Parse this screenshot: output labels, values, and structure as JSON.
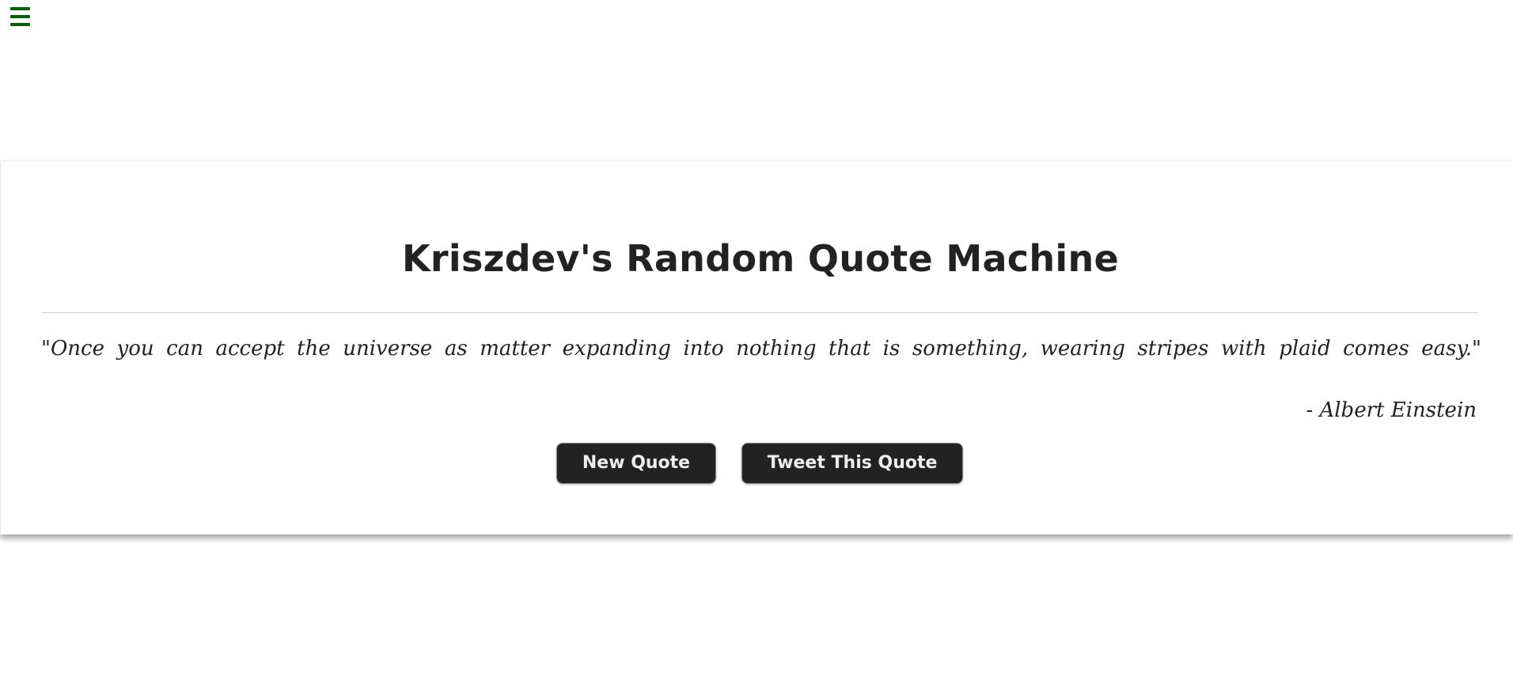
{
  "nav": {
    "menu_icon": "hamburger-menu-icon",
    "menu_color": "#006400"
  },
  "card": {
    "title": "Kriszdev's Random Quote Machine",
    "quote": "\"Once you can accept the universe as matter expanding into nothing that is something, wearing stripes with plaid comes easy.\"",
    "author": "- Albert Einstein"
  },
  "actions": {
    "new_quote_label": "New Quote",
    "tweet_label": "Tweet This Quote",
    "button_color": "#222222"
  }
}
